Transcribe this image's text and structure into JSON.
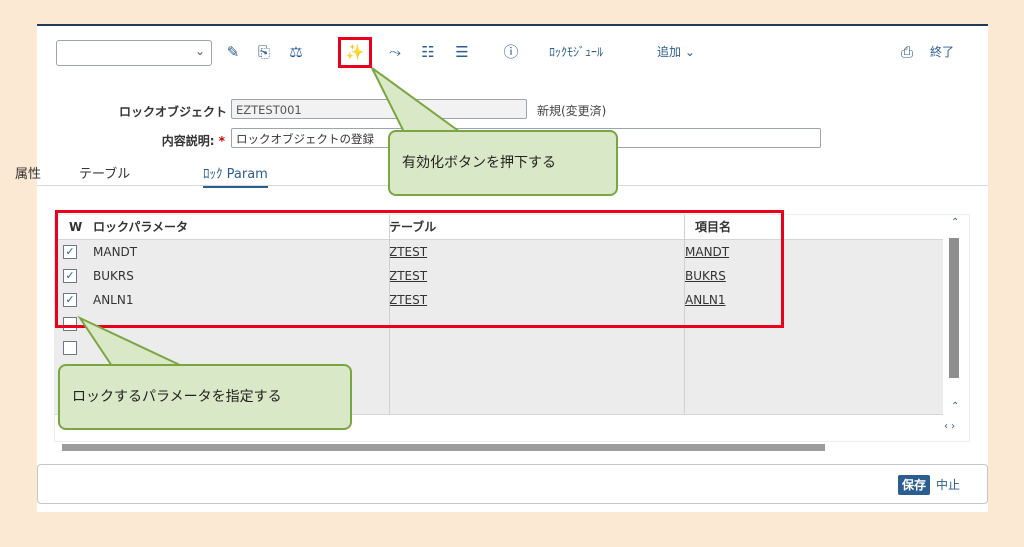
{
  "toolbar": {
    "dropdown_value": "",
    "lock_module_label": "ﾛｯｸﾓｼﾞｭｰﾙ",
    "add_label": "追加",
    "exit_label": "終了"
  },
  "form": {
    "lock_object_label": "ロックオブジェクト",
    "lock_object_value": "EZTEST001",
    "status_text": "新規(変更済)",
    "description_label": "内容説明:",
    "required_mark": "*",
    "description_value": "ロックオブジェクトの登録"
  },
  "tabs": [
    {
      "label": "属性"
    },
    {
      "label": "テーブル"
    },
    {
      "label": "ﾛｯｸ Param"
    }
  ],
  "table": {
    "headers": {
      "w": "W",
      "param": "ロックパラメータ",
      "table": "テーブル",
      "field": "項目名"
    },
    "rows": [
      {
        "checked": true,
        "param": "MANDT",
        "table": "ZTEST",
        "field": "MANDT"
      },
      {
        "checked": true,
        "param": "BUKRS",
        "table": "ZTEST",
        "field": "BUKRS"
      },
      {
        "checked": true,
        "param": "ANLN1",
        "table": "ZTEST",
        "field": "ANLN1"
      },
      {
        "checked": false,
        "param": "",
        "table": "",
        "field": ""
      },
      {
        "checked": false,
        "param": "",
        "table": "",
        "field": ""
      }
    ]
  },
  "callouts": {
    "activate": "有効化ボタンを押下する",
    "params": "ロックするパラメータを指定する"
  },
  "footer": {
    "save_label": "保存",
    "cancel_label": "中止"
  },
  "colors": {
    "accent": "#2b5d91",
    "highlight": "#e8001c",
    "callout_fill": "#d9e8c6",
    "callout_border": "#7aa642",
    "background": "#fce9d3"
  }
}
